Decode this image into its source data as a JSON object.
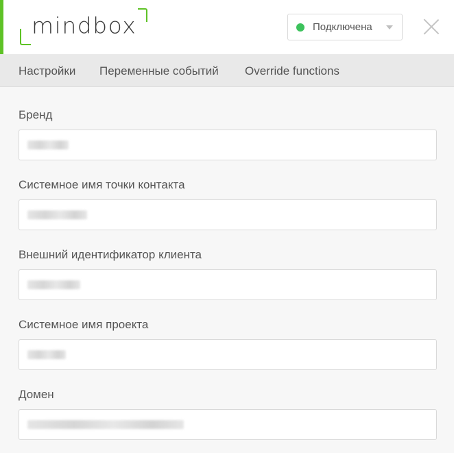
{
  "logo": {
    "text": "mindbox"
  },
  "status": {
    "label": "Подключена",
    "dot_color": "#3cc25c",
    "icon": "chevron-down-icon"
  },
  "tabs": [
    {
      "label": "Настройки"
    },
    {
      "label": "Переменные событий"
    },
    {
      "label": "Override functions"
    }
  ],
  "fields": [
    {
      "label": "Бренд",
      "value_redacted": true
    },
    {
      "label": "Системное имя точки контакта",
      "value_redacted": true
    },
    {
      "label": "Внешний идентификатор клиента",
      "value_redacted": true
    },
    {
      "label": "Системное имя проекта",
      "value_redacted": true
    },
    {
      "label": "Домен",
      "value_redacted": true
    }
  ],
  "colors": {
    "accent": "#5ec226",
    "tab_bar": "#e9e9e9",
    "background": "#f7f7f7"
  }
}
